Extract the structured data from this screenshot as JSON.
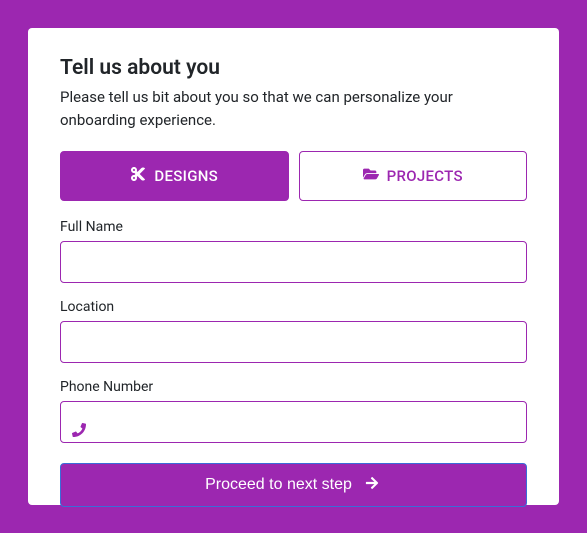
{
  "header": {
    "title": "Tell us about you",
    "subtitle": "Please tell us bit about you so that we can personalize your onboarding experience."
  },
  "tabs": {
    "designs": "DESIGNS",
    "projects": "PROJECTS"
  },
  "fields": {
    "full_name_label": "Full Name",
    "location_label": "Location",
    "phone_label": "Phone Number"
  },
  "actions": {
    "proceed": "Proceed to next step"
  },
  "colors": {
    "primary": "#9c27b0"
  }
}
